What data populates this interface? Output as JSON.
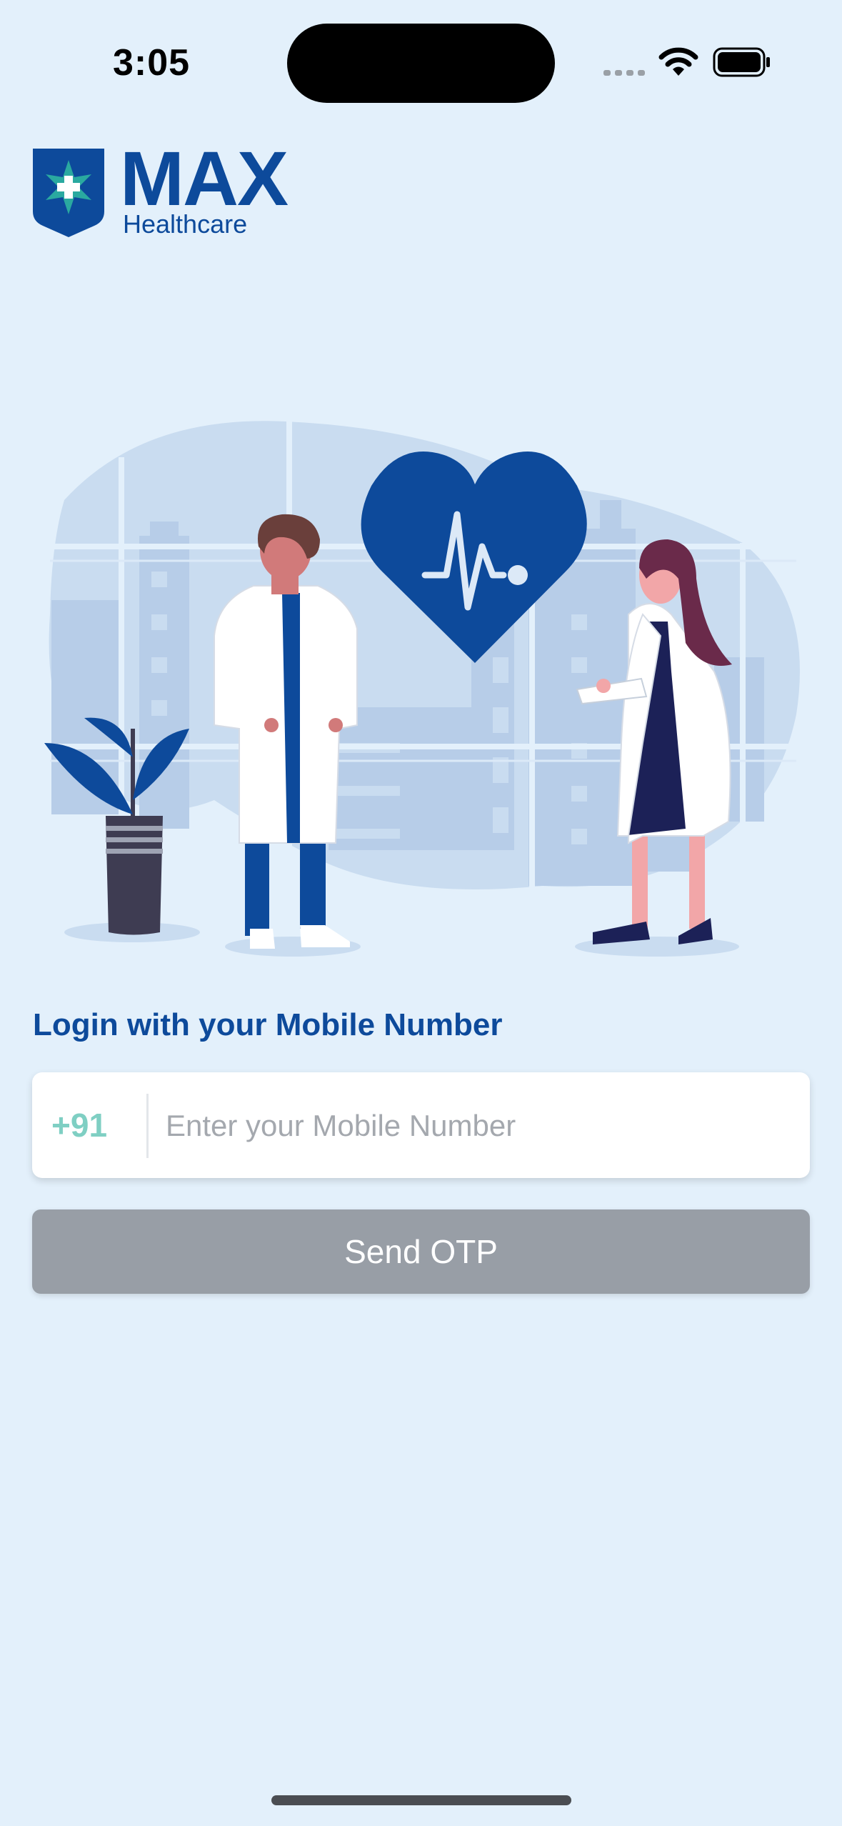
{
  "status_bar": {
    "time": "3:05"
  },
  "brand": {
    "name": "MAX",
    "tagline": "Healthcare",
    "primary_color": "#0d4a9b",
    "accent_color": "#2aa9a0"
  },
  "illustration": {
    "icons": [
      "heart-pulse-icon",
      "plant-icon",
      "doctor-male-icon",
      "doctor-female-icon"
    ]
  },
  "login": {
    "heading": "Login with your Mobile Number",
    "country_code": "+91",
    "phone_placeholder": "Enter your Mobile Number",
    "phone_value": "",
    "send_button_label": "Send OTP",
    "button_color_disabled": "#989ea6"
  }
}
